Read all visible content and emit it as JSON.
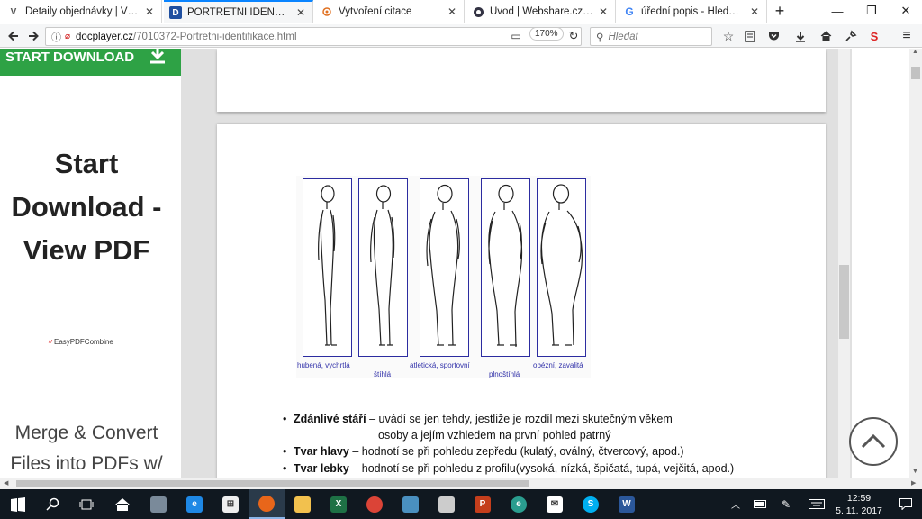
{
  "tabs": [
    {
      "label": "Detaily objednávky | VŠpráce",
      "icon": "v-logo-icon",
      "active": false
    },
    {
      "label": "PORTRÉTNÍ IDENTIFIKACE -",
      "icon": "docplayer-icon",
      "active": true
    },
    {
      "label": "Vytvoření citace",
      "icon": "citation-icon",
      "active": false
    },
    {
      "label": "Úvod | Webshare.cz - moder",
      "icon": "webshare-icon",
      "active": false
    },
    {
      "label": "úřední popis - Hledat Googl",
      "icon": "google-icon",
      "active": false
    }
  ],
  "new_tab": "+",
  "window_controls": {
    "minimize": "—",
    "restore": "❐",
    "close": "✕"
  },
  "nav": {
    "url_host": "docplayer.cz",
    "url_path": "/7010372-Portretni-identifikace.html",
    "zoom": "170%",
    "search_placeholder": "Hledat"
  },
  "ad": {
    "start_button": "START DOWNLOAD",
    "headline_line1": "Start",
    "headline_line2": "Download -",
    "headline_line3": "View PDF",
    "brand": "EasyPDFCombine",
    "subline1": "Merge & Convert",
    "subline2": "Files into PDFs w/"
  },
  "figure": {
    "labels": [
      "hubená, vychrtlá",
      "štíhlá",
      "atletická, sportovní",
      "plnoštíhlá",
      "obézní, zavalitá"
    ]
  },
  "bullets": [
    {
      "bold": "Zdánlivé stáří",
      "text": " – uvádí se jen tehdy, jestliže je rozdíl mezi skutečným věkem"
    },
    {
      "bold": "",
      "text": "osoby a jejím vzhledem na první pohled patrný"
    },
    {
      "bold": "Tvar hlavy",
      "text": " – hodnotí se při pohledu zepředu (kulatý, oválný, čtvercový, apod.)"
    },
    {
      "bold": "Tvar lebky",
      "text": " – hodnotí se při pohledu z profilu(vysoká, nízká, špičatá, tupá, vejčitá, apod.)"
    }
  ],
  "clock": {
    "time": "12:59",
    "date": "5. 11. 2017"
  },
  "colors": {
    "ad_green": "#2ea245",
    "figure_box": "#2c2ca0",
    "taskbar": "#101820"
  }
}
